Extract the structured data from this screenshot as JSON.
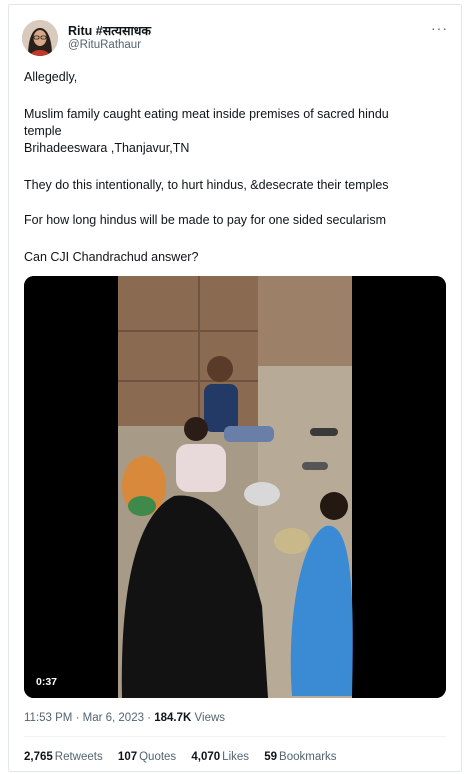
{
  "author": {
    "display_name": "Ritu #सत्यसाधक",
    "handle": "@RituRathaur"
  },
  "more_menu": "···",
  "tweet": {
    "lines": [
      "Allegedly,",
      "Muslim family caught eating meat inside premises of sacred hindu",
      "temple",
      "Brihadeeswara ,Thanjavur,TN",
      "They do this intentionally, to hurt hindus, &desecrate their temples",
      "For how long hindus will be made to pay for one sided secularism",
      "Can CJI Chandrachud answer?"
    ]
  },
  "media": {
    "duration": "0:37"
  },
  "meta": {
    "time": "11:53 PM",
    "separator": "·",
    "date": "Mar 6, 2023",
    "views_count": "184.7K",
    "views_label": "Views"
  },
  "stats": {
    "retweets_count": "2,765",
    "retweets_label": "Retweets",
    "quotes_count": "107",
    "quotes_label": "Quotes",
    "likes_count": "4,070",
    "likes_label": "Likes",
    "bookmarks_count": "59",
    "bookmarks_label": "Bookmarks"
  },
  "colors": {
    "text": "#0f1419",
    "secondary": "#536471",
    "border": "#e1e8ed"
  }
}
